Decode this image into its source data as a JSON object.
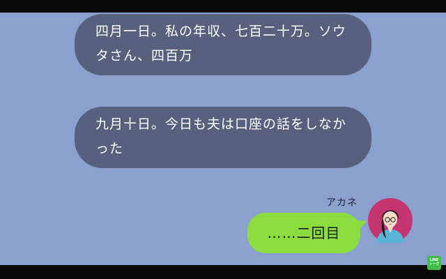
{
  "messages": [
    {
      "text": "四月一日。私の年収、七百二十万。ソウタさん、四百万"
    },
    {
      "text": "九月十日。今日も夫は口座の話をしなかった"
    }
  ],
  "reply": {
    "sender": "アカネ",
    "text": "……二回目"
  },
  "logo": {
    "line1": "LINE",
    "line2": "トーク"
  },
  "colors": {
    "chat_background": "#8aa0cf",
    "narration_bubble": "#57617e",
    "own_bubble": "#8bdc3e"
  }
}
